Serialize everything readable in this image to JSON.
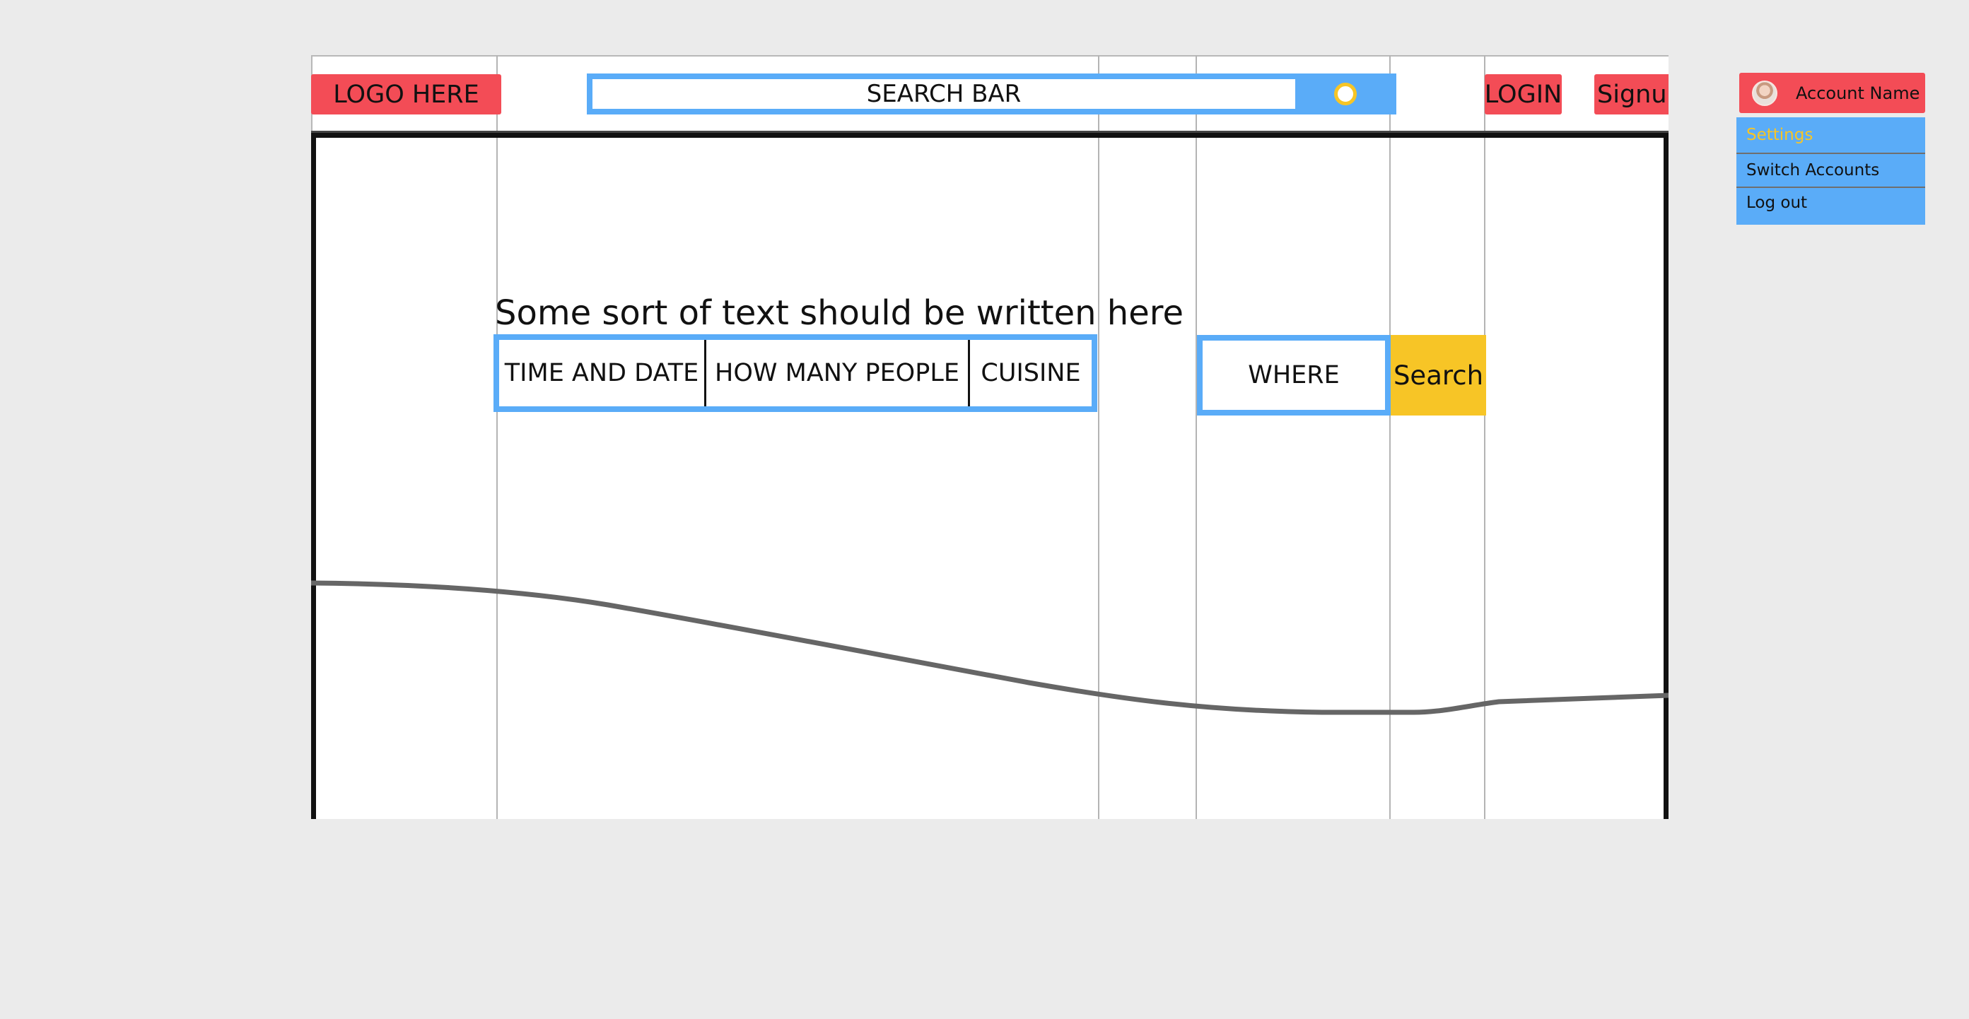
{
  "header": {
    "logo_label": "LOGO HERE",
    "search_placeholder": "SEARCH BAR",
    "login_label": "LOGIN",
    "signup_label": "Signup"
  },
  "hero": {
    "headline": "Some sort of text should be written here",
    "filters": [
      {
        "label": "TIME AND DATE"
      },
      {
        "label": "HOW MANY PEOPLE"
      },
      {
        "label": "CUISINE"
      }
    ],
    "where_label": "WHERE",
    "search_button_label": "Search"
  },
  "account": {
    "name": "Account Name",
    "menu": [
      {
        "label": "Settings"
      },
      {
        "label": "Switch Accounts"
      },
      {
        "label": "Log out"
      }
    ]
  },
  "colors": {
    "background": "#ebebeb",
    "primary_blue": "#5aacf8",
    "red_button": "#f34c56",
    "yellow_accent": "#f7c526",
    "border_dark": "#111111",
    "guide_line": "#b4b4b4"
  },
  "icons": [
    "toggle-icon",
    "avatar"
  ]
}
